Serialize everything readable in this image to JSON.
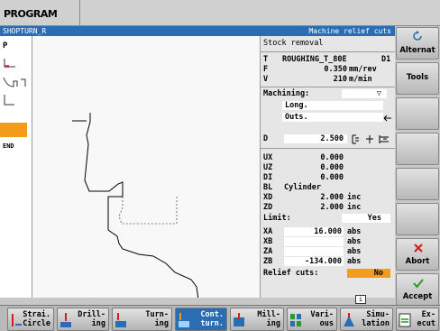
{
  "app": {
    "area_title": "PROGRAM"
  },
  "header": {
    "left": "SHOPTURN_R",
    "right": "Machine relief cuts"
  },
  "leftcol": {
    "items": [
      "P",
      "END"
    ]
  },
  "panel": {
    "title": "Stock removal",
    "T": {
      "label": "T",
      "value": "ROUGHING_T_80E",
      "suffix": "D1"
    },
    "F": {
      "label": "F",
      "value": "0.350",
      "unit": "mm/rev"
    },
    "V": {
      "label": "V",
      "value": "210",
      "unit": "m/min"
    },
    "machining": {
      "label": "Machining:",
      "value": "▽"
    },
    "direction": "Long.",
    "position": "Outs.",
    "D": {
      "label": "D",
      "value": "2.500"
    },
    "UX": {
      "label": "UX",
      "value": "0.000"
    },
    "UZ": {
      "label": "UZ",
      "value": "0.000"
    },
    "DI": {
      "label": "DI",
      "value": "0.000"
    },
    "BL": {
      "label": "BL",
      "value": "Cylinder"
    },
    "XD": {
      "label": "XD",
      "value": "2.000",
      "unit": "inc"
    },
    "ZD": {
      "label": "ZD",
      "value": "2.000",
      "unit": "inc"
    },
    "limit": {
      "label": "Limit:",
      "value": "Yes"
    },
    "XA": {
      "label": "XA",
      "value": "16.000",
      "unit": "abs"
    },
    "XB": {
      "label": "XB",
      "value": "",
      "unit": "abs"
    },
    "ZA": {
      "label": "ZA",
      "value": "",
      "unit": "abs"
    },
    "ZB": {
      "label": "ZB",
      "value": "-134.000",
      "unit": "abs"
    },
    "relief": {
      "label": "Relief cuts:",
      "value": "No"
    }
  },
  "vsoftkeys": [
    "Alternat",
    "Tools",
    "",
    "",
    "",
    "",
    "Abort",
    "Accept"
  ],
  "hsoftkeys": [
    {
      "label": "Strai.\nCircle"
    },
    {
      "label": "Drill-\ning"
    },
    {
      "label": "Turn-\ning"
    },
    {
      "label": "Cont.\nturn."
    },
    {
      "label": "Mill-\ning"
    },
    {
      "label": "Vari-\nous"
    },
    {
      "label": "Simu-\nlation"
    },
    {
      "label": "Ex-\necut"
    }
  ],
  "status": {
    "info": "i"
  },
  "colors": {
    "accent": "#2a6db3",
    "highlight": "#f39c1c",
    "abort": "#d02020",
    "accept": "#2a9a2a"
  }
}
